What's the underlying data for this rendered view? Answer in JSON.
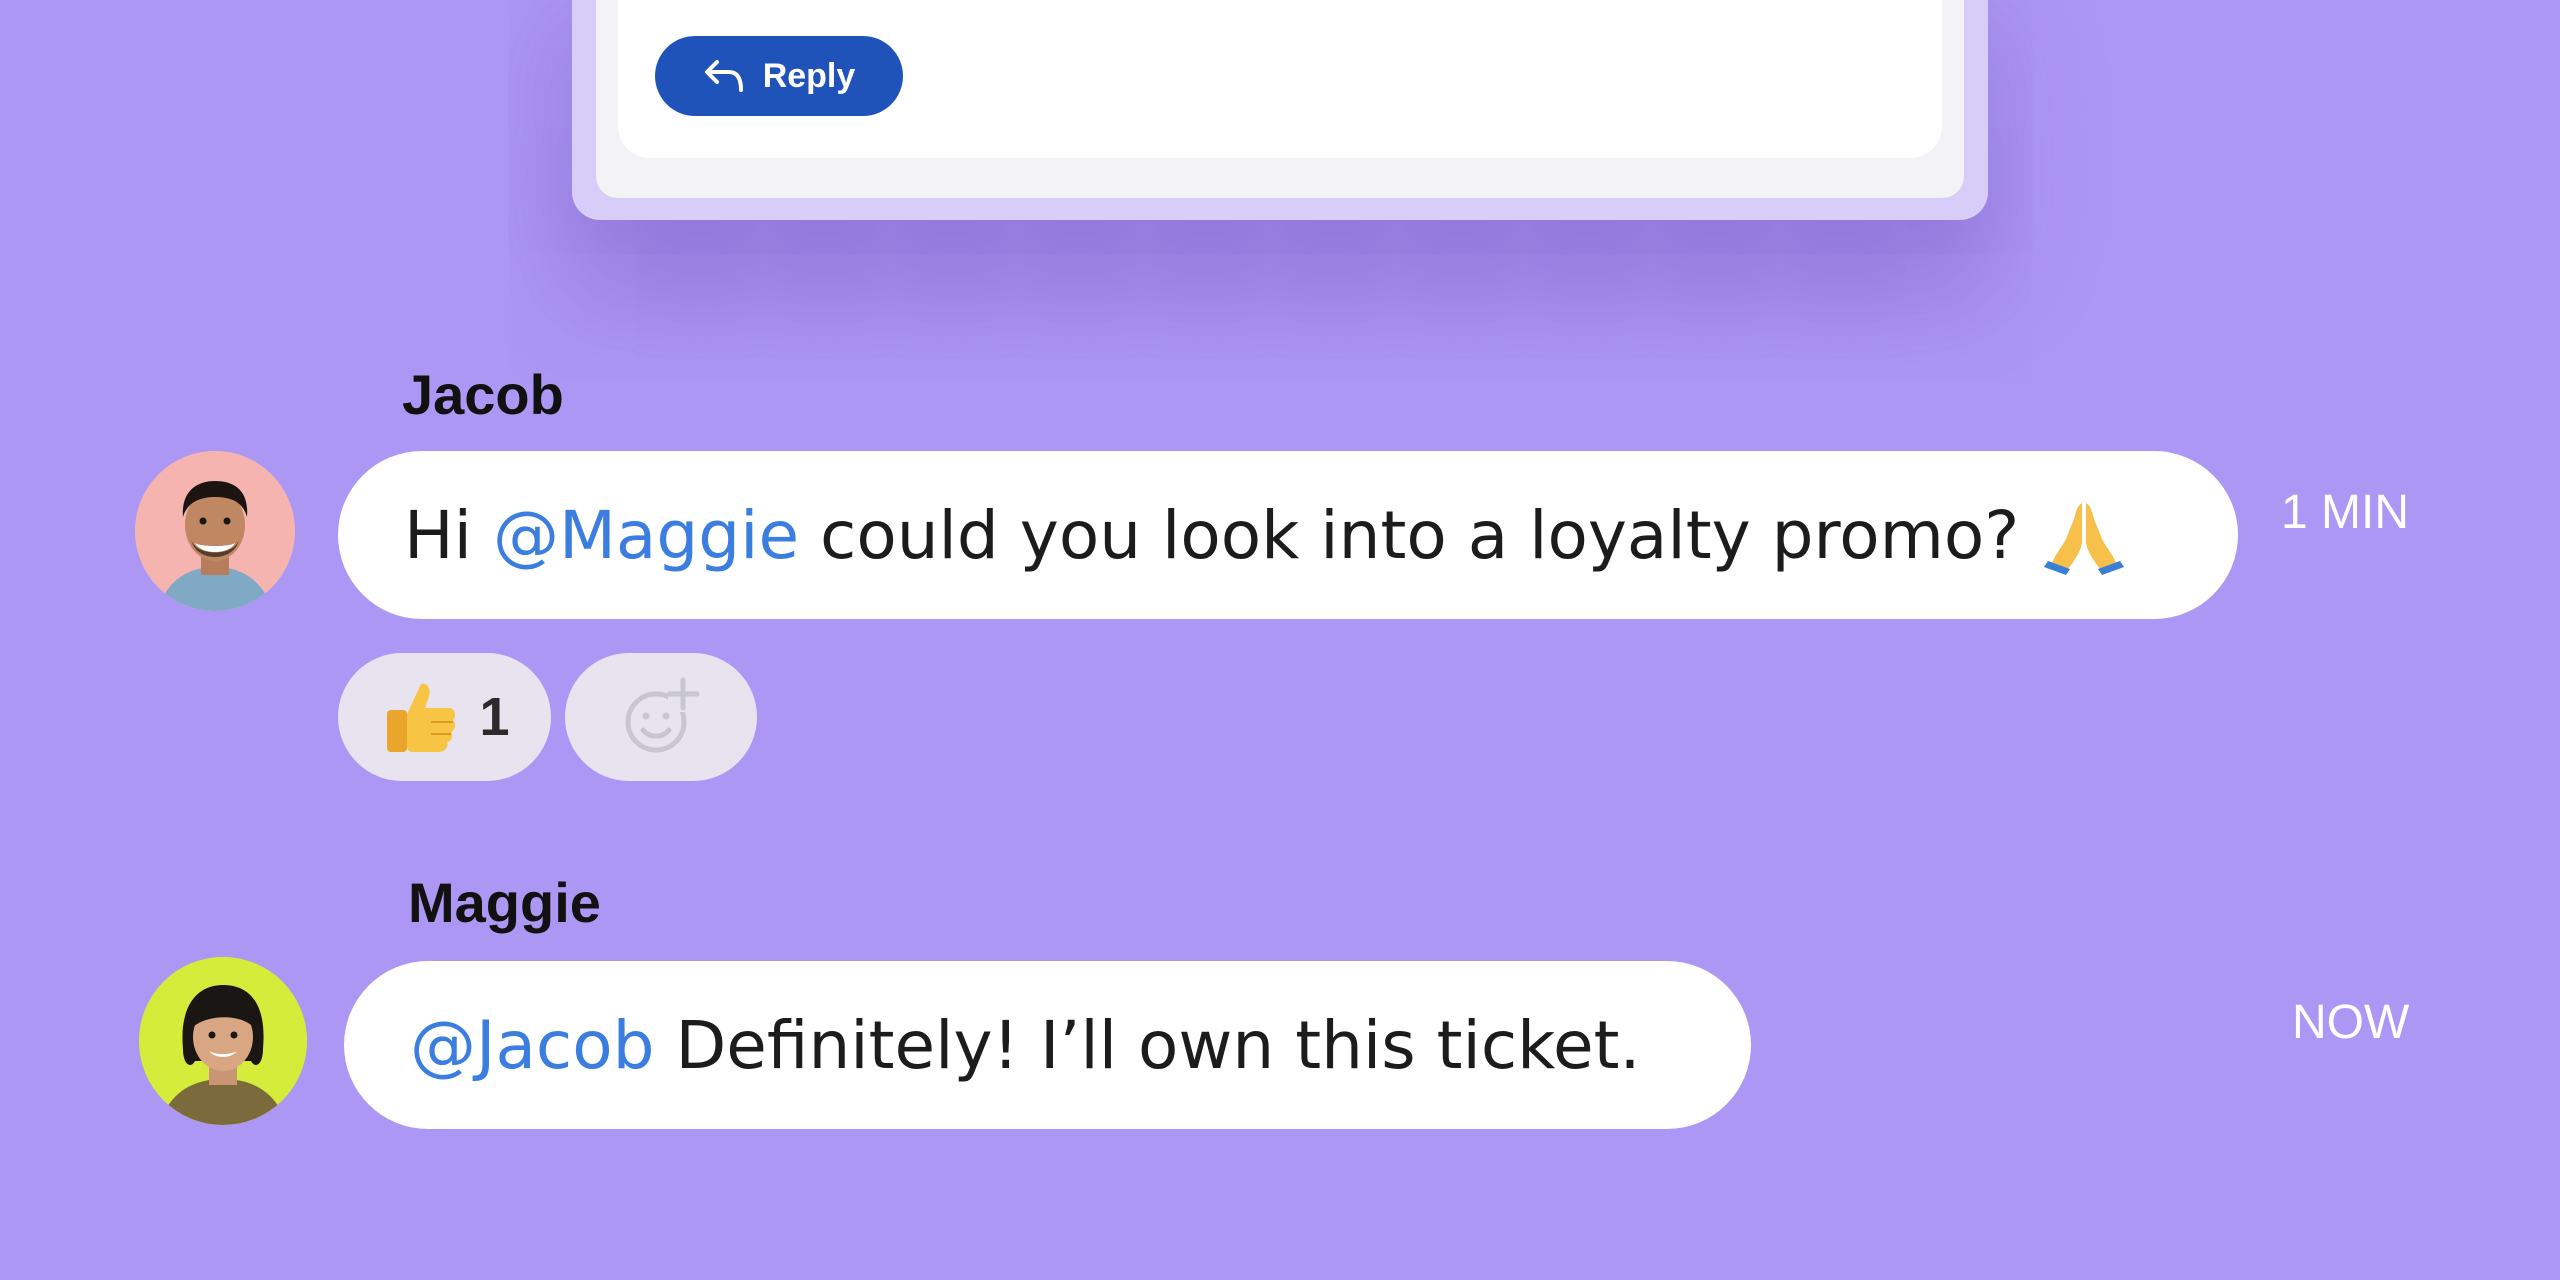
{
  "reply_card": {
    "reply_label": "Reply"
  },
  "messages": [
    {
      "sender": "Jacob",
      "text_prefix": "Hi ",
      "mention": "@Maggie",
      "text_suffix": " could you look into a loyalty promo? ",
      "time": "1 MIN",
      "reactions": [
        {
          "emoji": "thumbs-up-emoji",
          "count": "1"
        }
      ],
      "add_reaction_icon": "add-reaction-icon"
    },
    {
      "sender": "Maggie",
      "mention": "@Jacob",
      "text_suffix": " Definitely! I’ll own this ticket.",
      "time": "NOW"
    }
  ],
  "colors": {
    "background": "#ad97f4",
    "reply_button": "#2053ba",
    "mention": "#3b7ee0",
    "jacob_avatar_bg": "#f6b4b0",
    "maggie_avatar_bg": "#d6ec3a"
  }
}
